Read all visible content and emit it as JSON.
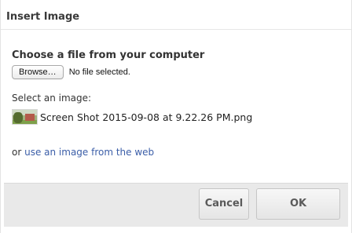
{
  "dialog": {
    "title": "Insert Image"
  },
  "upload": {
    "heading": "Choose a file from your computer",
    "browse_label": "Browse…",
    "file_status": "No file selected."
  },
  "gallery": {
    "label": "Select an image:",
    "images": [
      {
        "name": "Screen Shot 2015-09-08 at 9.22.26 PM.png",
        "icon": "image-thumbnail"
      }
    ]
  },
  "web": {
    "prefix": "or ",
    "link_text": "use an image from the web"
  },
  "footer": {
    "cancel_label": "Cancel",
    "ok_label": "OK"
  },
  "colors": {
    "link": "#3b5ea8",
    "footer_bg": "#e9e9e9"
  }
}
